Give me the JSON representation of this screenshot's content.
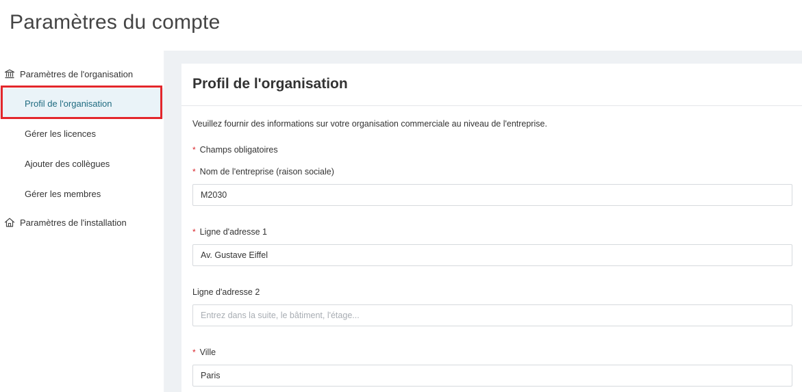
{
  "header": {
    "title": "Paramètres du compte"
  },
  "sidebar": {
    "org_settings": {
      "label": "Paramètres de l'organisation",
      "icon": "bank-icon"
    },
    "items": [
      {
        "label": "Profil de l'organisation",
        "active": true
      },
      {
        "label": "Gérer les licences",
        "active": false
      },
      {
        "label": "Ajouter des collègues",
        "active": false
      },
      {
        "label": "Gérer les membres",
        "active": false
      }
    ],
    "install_settings": {
      "label": "Paramètres de l'installation",
      "icon": "home-icon"
    }
  },
  "main": {
    "title": "Profil de l'organisation",
    "intro": "Veuillez fournir des informations sur votre organisation commerciale au niveau de l'entreprise.",
    "required_note": "Champs obligatoires",
    "required_marker": "*",
    "fields": {
      "company_name": {
        "label": "Nom de l'entreprise (raison sociale)",
        "value": "M2030",
        "placeholder": "",
        "required": true
      },
      "address1": {
        "label": "Ligne d'adresse 1",
        "value": "Av. Gustave Eiffel",
        "placeholder": "",
        "required": true
      },
      "address2": {
        "label": "Ligne d'adresse 2",
        "value": "",
        "placeholder": "Entrez dans la suite, le bâtiment, l'étage...",
        "required": false
      },
      "city": {
        "label": "Ville",
        "value": "Paris",
        "placeholder": "",
        "required": true
      }
    }
  },
  "colors": {
    "accent_active_bg": "#eaf3f8",
    "accent_active_text": "#1f6b80",
    "highlight": "#e3262b",
    "required_star": "#d9262c",
    "content_bg": "#eef1f4"
  }
}
